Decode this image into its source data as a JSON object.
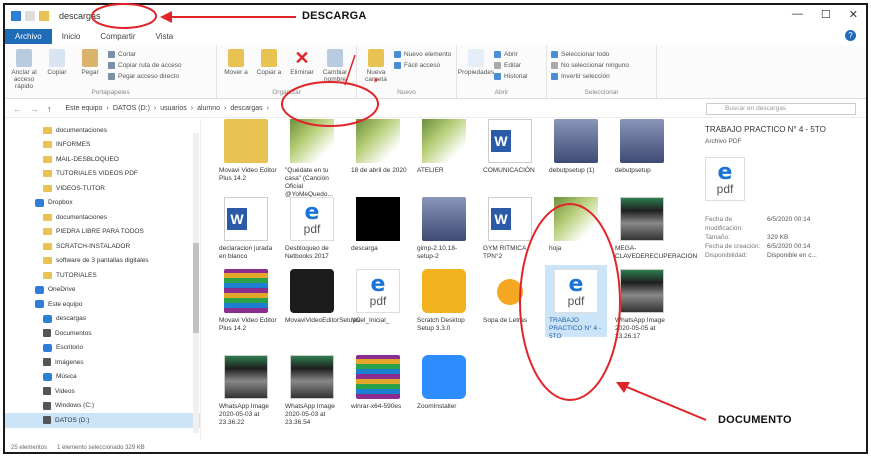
{
  "window": {
    "title": "descargas",
    "controls": [
      "—",
      "☐",
      "✕"
    ]
  },
  "tabs": [
    {
      "label": "Archivo",
      "active": true
    },
    {
      "label": "Inicio",
      "active": false
    },
    {
      "label": "Compartir",
      "active": false
    },
    {
      "label": "Vista",
      "active": false
    }
  ],
  "ribbon": {
    "portapapeles": {
      "name": "Portapapeles",
      "anclar": "Anclar al acceso rápido",
      "copiar": "Copiar",
      "pegar": "Pegar",
      "cortar": "Cortar",
      "copiar_ruta": "Copiar ruta de acceso",
      "pegar_acceso": "Pegar acceso directo"
    },
    "organizar": {
      "name": "Organizar",
      "mover": "Mover a",
      "copiar": "Copiar a",
      "eliminar": "Eliminar",
      "cambiar": "Cambiar nombre"
    },
    "nuevo": {
      "name": "Nuevo",
      "carpeta": "Nueva carpeta",
      "elemento": "Nuevo elemento",
      "facil": "Fácil acceso"
    },
    "abrir": {
      "name": "Abrir",
      "propiedades": "Propiedades",
      "abrir": "Abrir",
      "editar": "Editar",
      "historial": "Historial"
    },
    "seleccionar": {
      "name": "Seleccionar",
      "todo": "Seleccionar todo",
      "ninguno": "No seleccionar ninguno",
      "invertir": "Invertir selección"
    }
  },
  "address": {
    "path": [
      "Este equipo",
      "DATOS (D:)",
      "usuarios",
      "alumno",
      "descargas"
    ],
    "search_placeholder": "Buscar en descargas"
  },
  "sidebar": [
    {
      "label": "documentaciones",
      "icon": "folder",
      "level": 2
    },
    {
      "label": "INFORMES",
      "icon": "folder",
      "level": 2
    },
    {
      "label": "MAIL-DESBLOQUEO",
      "icon": "folder",
      "level": 2
    },
    {
      "label": "TUTORIALES VIDEOS PDF",
      "icon": "folder",
      "level": 2
    },
    {
      "label": "VIDEOS-TUTOR",
      "icon": "folder",
      "level": 2
    },
    {
      "label": "Dropbox",
      "icon": "dropbox",
      "level": 1
    },
    {
      "label": "documentaciones",
      "icon": "folder",
      "level": 2
    },
    {
      "label": "PIEDRA LIBRE PARA TODOS",
      "icon": "folder",
      "level": 2
    },
    {
      "label": "SCRATCH-INSTALADOR",
      "icon": "folder",
      "level": 2
    },
    {
      "label": "software de 3 pantallas digitales",
      "icon": "folder",
      "level": 2
    },
    {
      "label": "TUTORIALES",
      "icon": "folder",
      "level": 2
    },
    {
      "label": "OneDrive",
      "icon": "cloud",
      "level": 1
    },
    {
      "label": "Este equipo",
      "icon": "pc",
      "level": 1
    },
    {
      "label": "descargas",
      "icon": "download",
      "level": 2
    },
    {
      "label": "Documentos",
      "icon": "doc",
      "level": 2
    },
    {
      "label": "Escritorio",
      "icon": "desktop",
      "level": 2
    },
    {
      "label": "Imágenes",
      "icon": "image",
      "level": 2
    },
    {
      "label": "Música",
      "icon": "music",
      "level": 2
    },
    {
      "label": "Videos",
      "icon": "video",
      "level": 2
    },
    {
      "label": "Windows (C:)",
      "icon": "drive",
      "level": 2
    },
    {
      "label": "DATOS (D:)",
      "icon": "drive",
      "level": 2,
      "selected": true
    }
  ],
  "files": [
    {
      "label": "Movavi Video Editor Plus 14.2",
      "kind": "folder"
    },
    {
      "label": "\"Quédate en tu casa\" (Canción Oficial @YoMeQuedo...",
      "kind": "photo"
    },
    {
      "label": "18 de abril de 2020",
      "kind": "photo"
    },
    {
      "label": "ATELIER",
      "kind": "photo"
    },
    {
      "label": "COMUNICACIÓN",
      "kind": "wdoc"
    },
    {
      "label": "debutpsetup (1)",
      "kind": "setup"
    },
    {
      "label": "debutpsetup",
      "kind": "setup"
    },
    {
      "label": "declaracion jurada en blanco",
      "kind": "wdoc"
    },
    {
      "label": "Desbloqueo de Netbooks 2017",
      "kind": "pdf"
    },
    {
      "label": "descarga",
      "kind": "blackbox"
    },
    {
      "label": "gimp-2.10.18-setup-2",
      "kind": "setup"
    },
    {
      "label": "GYM RITMICA TPN°2",
      "kind": "wdoc"
    },
    {
      "label": "hoja",
      "kind": "photo"
    },
    {
      "label": "MEGA-CLAVEDERECUPERACION",
      "kind": "phone"
    },
    {
      "label": "Movavi Video Editor Plus 14.2",
      "kind": "rar"
    },
    {
      "label": "MovaviVideoEditorSetupC",
      "kind": "vid"
    },
    {
      "label": "Nivel_Inicial_",
      "kind": "pdf"
    },
    {
      "label": "Scratch Desktop Setup 3.3.0",
      "kind": "yellow"
    },
    {
      "label": "Sopa de Letras",
      "kind": "cat"
    },
    {
      "label": "TRABAJO PRACTICO N° 4 - 5TO",
      "kind": "pdf",
      "selected": true
    },
    {
      "label": "WhatsApp Image 2020-05-05 at 23.26.17",
      "kind": "phone"
    },
    {
      "label": "WhatsApp Image 2020-05-03 at 23.36.22",
      "kind": "phone"
    },
    {
      "label": "WhatsApp Image 2020-05-03 at 23.36.54",
      "kind": "phone"
    },
    {
      "label": "winrar-x64-590es",
      "kind": "rar"
    },
    {
      "label": "ZoomInstaller",
      "kind": "zoom"
    }
  ],
  "details": {
    "name": "TRABAJO PRACTICO N° 4 - 5TO",
    "type": "Archivo PDF",
    "rows": [
      {
        "k": "Fecha de modificación:",
        "v": "6/5/2020 00:14"
      },
      {
        "k": "Tamaño:",
        "v": "329 KB"
      },
      {
        "k": "Fecha de creación:",
        "v": "6/5/2020 00:14"
      },
      {
        "k": "Disponibilidad:",
        "v": "Disponible en c..."
      }
    ]
  },
  "status": {
    "count": "25 elementos",
    "selection": "1 elemento seleccionado 329 KB"
  },
  "annotations": {
    "descarga": "DESCARGA",
    "documento": "DOCUMENTO"
  },
  "colors": {
    "accent": "#1f6bb8",
    "annotation_red": "#e0242a",
    "selection": "#cce4f7"
  }
}
